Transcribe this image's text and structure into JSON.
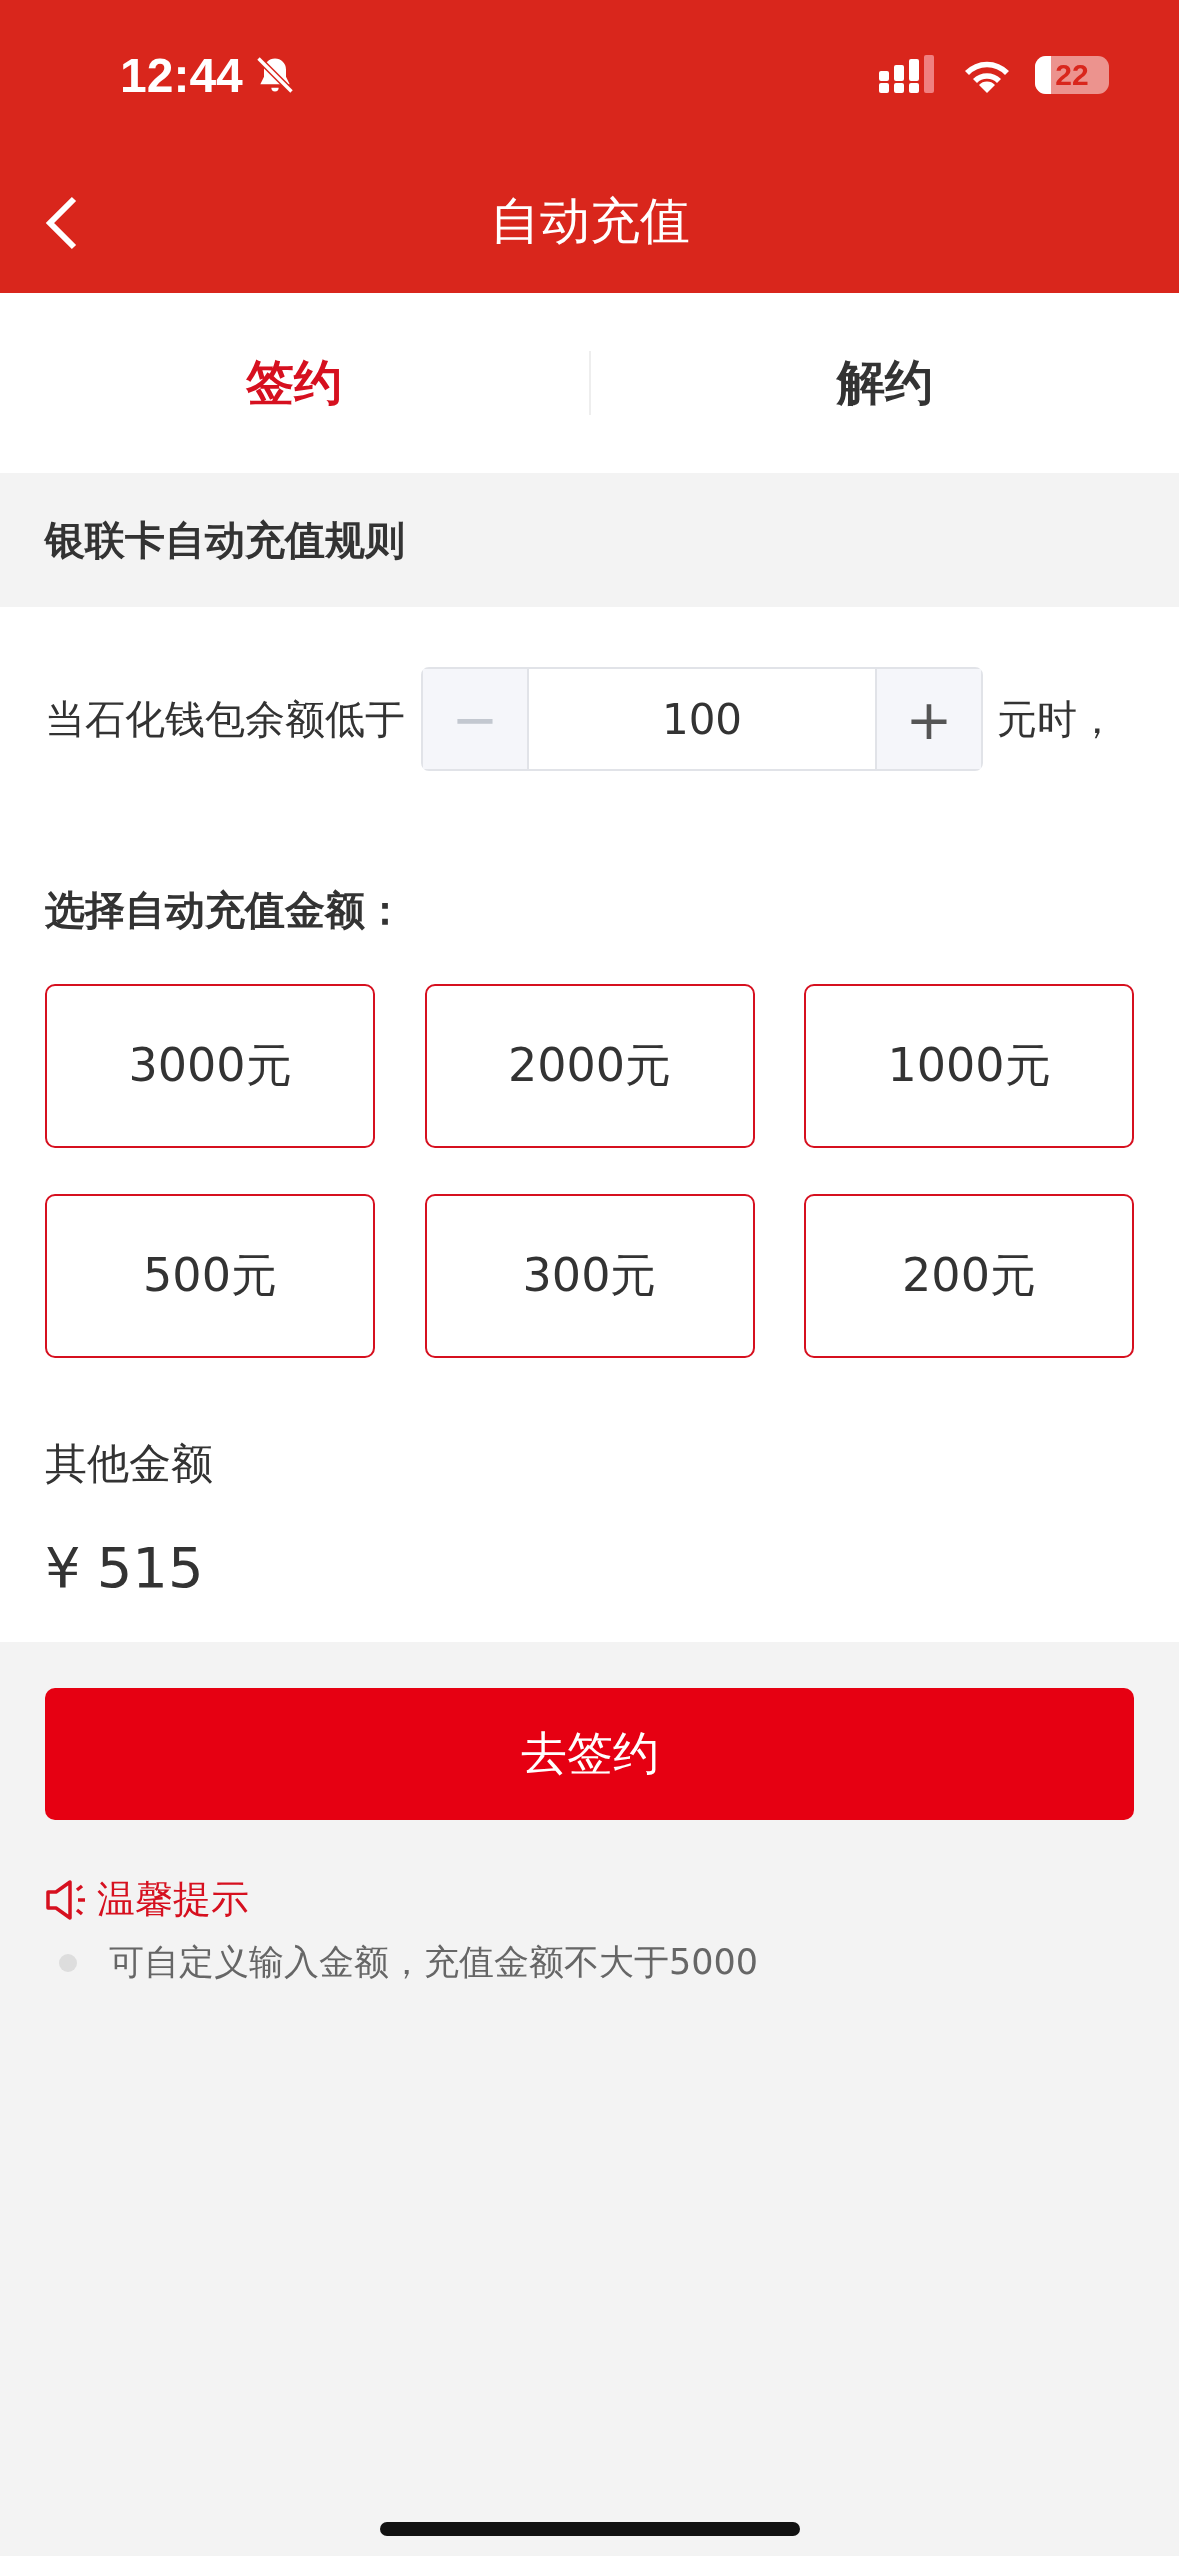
{
  "status_bar": {
    "time": "12:44",
    "battery": "22"
  },
  "nav": {
    "title": "自动充值"
  },
  "tabs": [
    {
      "label": "签约",
      "selected": true
    },
    {
      "label": "解约",
      "selected": false
    }
  ],
  "section_title": "银联卡自动充值规则",
  "threshold": {
    "prefix": "当石化钱包余额低于",
    "minus": "−",
    "value": "100",
    "plus": "+",
    "minus_disabled": true,
    "suffix": "元时，"
  },
  "amount_label": "选择自动充值金额：",
  "amounts": [
    {
      "label": "3000元",
      "selected": false
    },
    {
      "label": "2000元",
      "selected": false
    },
    {
      "label": "1000元",
      "selected": false
    },
    {
      "label": "500元",
      "selected": false
    },
    {
      "label": "300元",
      "selected": false
    },
    {
      "label": "200元",
      "selected": false
    }
  ],
  "other": {
    "label": "其他金额",
    "currency": "¥",
    "value": "515"
  },
  "submit": "去签约",
  "tips": {
    "title": "温馨提示",
    "items": [
      "可自定义输入金额，充值金额不大于5000"
    ]
  }
}
